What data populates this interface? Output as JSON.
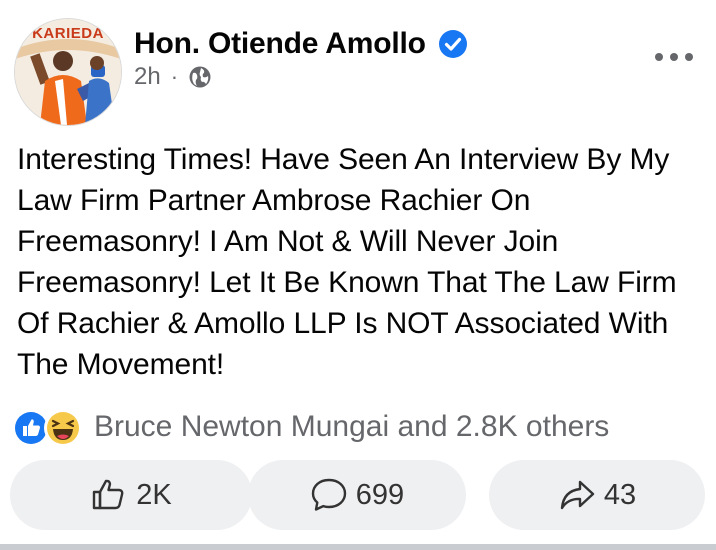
{
  "post": {
    "author": {
      "name": "Hon. Otiende Amollo",
      "avatar_text": "KARIEDA",
      "verified_icon": "verified-badge-icon"
    },
    "time": "2h",
    "separator": "·",
    "privacy_icon": "globe-icon",
    "more_icon": "more-options-icon",
    "text": "Interesting Times! Have Seen An Interview By My Law Firm Partner Ambrose Rachier On Freemasonry! I Am Not & Will Never Join Freemasonry! Let It Be Known That The Law Firm Of Rachier & Amollo LLP Is NOT Associated With The Movement!"
  },
  "reactions": {
    "icons": [
      "like-reaction-icon",
      "haha-reaction-icon"
    ],
    "summary": "Bruce Newton Mungai and 2.8K others"
  },
  "actions": {
    "like_count": "2K",
    "comment_count": "699",
    "share_count": "43"
  },
  "colors": {
    "primary_text": "#050505",
    "secondary_text": "#65676b",
    "facebook_blue": "#1877f2",
    "button_bg": "#eff0f2",
    "haha_yellow": "#f7c94a"
  }
}
